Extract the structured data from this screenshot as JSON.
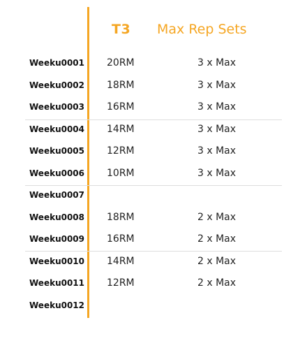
{
  "header": {
    "col1": "T3",
    "col2": "Max Rep Sets"
  },
  "rows": [
    {
      "week": "Weeku0001",
      "rm": "20RM",
      "sets": "3 x Max"
    },
    {
      "week": "Weeku0002",
      "rm": "18RM",
      "sets": "3 x Max"
    },
    {
      "week": "Weeku0003",
      "rm": "16RM",
      "sets": "3 x Max"
    },
    {
      "week": "Weeku0004",
      "rm": "14RM",
      "sets": "3 x Max"
    },
    {
      "week": "Weeku0005",
      "rm": "12RM",
      "sets": "3 x Max"
    },
    {
      "week": "Weeku0006",
      "rm": "10RM",
      "sets": "3 x Max"
    },
    {
      "week": "Weeku0007",
      "rm": "",
      "sets": ""
    },
    {
      "week": "Weeku0008",
      "rm": "18RM",
      "sets": "2 x Max"
    },
    {
      "week": "Weeku0009",
      "rm": "16RM",
      "sets": "2 x Max"
    },
    {
      "week": "Weeku0010",
      "rm": "14RM",
      "sets": "2 x Max"
    },
    {
      "week": "Weeku0011",
      "rm": "12RM",
      "sets": "2 x Max"
    },
    {
      "week": "Weeku0012",
      "rm": "",
      "sets": ""
    }
  ],
  "colors": {
    "accent": "#f5a623",
    "divider": "#dddddd"
  }
}
